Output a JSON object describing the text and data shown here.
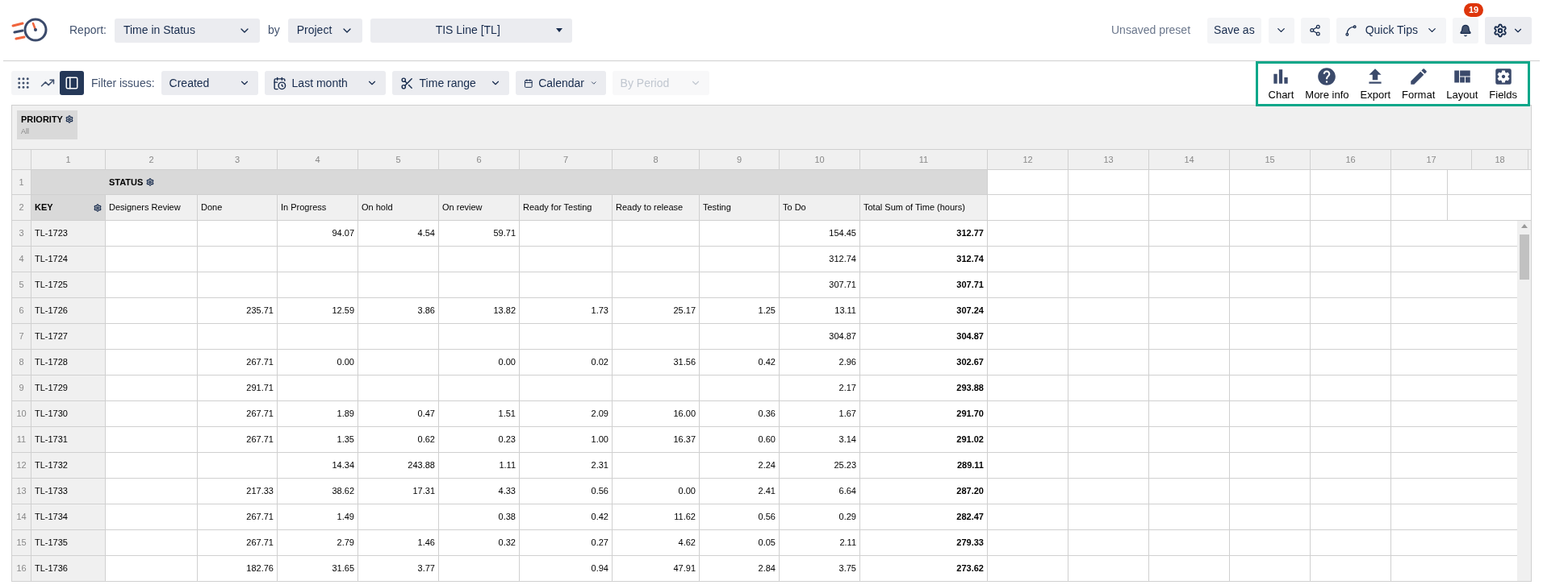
{
  "header": {
    "report_label": "Report:",
    "report_select": "Time in Status",
    "by_label": "by",
    "by_select": "Project",
    "project_select": "TIS Line [TL]",
    "preset_status": "Unsaved preset",
    "save_as": "Save as",
    "quick_tips": "Quick Tips",
    "notifications_count": "19"
  },
  "toolbar": {
    "views": [
      {
        "kind": "grid",
        "selected": false
      },
      {
        "kind": "chart",
        "selected": false
      },
      {
        "kind": "table",
        "selected": true
      }
    ],
    "filter_label": "Filter issues:",
    "filters": [
      {
        "kind": "select",
        "label": "Created",
        "disabled": false
      },
      {
        "kind": "period",
        "label": "Last month",
        "disabled": false
      },
      {
        "kind": "range",
        "label": "Time range",
        "disabled": false
      },
      {
        "kind": "calendar",
        "label": "Calendar",
        "disabled": false
      },
      {
        "kind": "select",
        "label": "By Period",
        "disabled": true
      }
    ],
    "actions": [
      {
        "kind": "chart",
        "label": "Chart"
      },
      {
        "kind": "info",
        "label": "More info"
      },
      {
        "kind": "export",
        "label": "Export"
      },
      {
        "kind": "format",
        "label": "Format"
      },
      {
        "kind": "layout",
        "label": "Layout"
      },
      {
        "kind": "fields",
        "label": "Fields"
      }
    ]
  },
  "priority_filter": {
    "label": "PRIORITY",
    "value": "All"
  },
  "table": {
    "column_numbers": [
      "1",
      "2",
      "3",
      "4",
      "5",
      "6",
      "7",
      "8",
      "9",
      "10",
      "11",
      "12",
      "13",
      "14",
      "15",
      "16",
      "17",
      "18"
    ],
    "row_numbers": [
      "1",
      "2"
    ],
    "status_header": "STATUS",
    "key_header": "KEY",
    "statuses": [
      "Designers Review",
      "Done",
      "In Progress",
      "On hold",
      "On review",
      "Ready for Testing",
      "Ready to release",
      "Testing",
      "To Do"
    ],
    "total_header": "Total Sum of Time (hours)",
    "rows": [
      {
        "number": "3",
        "key": "TL-1723",
        "cells": [
          {
            "kind": "empty"
          },
          {
            "kind": "empty"
          },
          {
            "kind": "value",
            "value": "94.07"
          },
          {
            "kind": "value",
            "value": "4.54"
          },
          {
            "kind": "value",
            "value": "59.71"
          },
          {
            "kind": "empty"
          },
          {
            "kind": "empty"
          },
          {
            "kind": "empty"
          },
          {
            "kind": "value",
            "value": "154.45"
          }
        ],
        "total": "312.77"
      },
      {
        "number": "4",
        "key": "TL-1724",
        "cells": [
          {
            "kind": "empty"
          },
          {
            "kind": "empty"
          },
          {
            "kind": "empty"
          },
          {
            "kind": "empty"
          },
          {
            "kind": "empty"
          },
          {
            "kind": "empty"
          },
          {
            "kind": "empty"
          },
          {
            "kind": "empty"
          },
          {
            "kind": "value",
            "value": "312.74"
          }
        ],
        "total": "312.74"
      },
      {
        "number": "5",
        "key": "TL-1725",
        "cells": [
          {
            "kind": "empty"
          },
          {
            "kind": "empty"
          },
          {
            "kind": "empty"
          },
          {
            "kind": "empty"
          },
          {
            "kind": "empty"
          },
          {
            "kind": "empty"
          },
          {
            "kind": "empty"
          },
          {
            "kind": "empty"
          },
          {
            "kind": "value",
            "value": "307.71"
          }
        ],
        "total": "307.71"
      },
      {
        "number": "6",
        "key": "TL-1726",
        "cells": [
          {
            "kind": "empty"
          },
          {
            "kind": "value",
            "value": "235.71"
          },
          {
            "kind": "value",
            "value": "12.59"
          },
          {
            "kind": "value",
            "value": "3.86"
          },
          {
            "kind": "value",
            "value": "13.82"
          },
          {
            "kind": "value",
            "value": "1.73"
          },
          {
            "kind": "value",
            "value": "25.17"
          },
          {
            "kind": "value",
            "value": "1.25"
          },
          {
            "kind": "value",
            "value": "13.11"
          }
        ],
        "total": "307.24"
      },
      {
        "number": "7",
        "key": "TL-1727",
        "cells": [
          {
            "kind": "empty"
          },
          {
            "kind": "empty"
          },
          {
            "kind": "empty"
          },
          {
            "kind": "empty"
          },
          {
            "kind": "empty"
          },
          {
            "kind": "empty"
          },
          {
            "kind": "empty"
          },
          {
            "kind": "empty"
          },
          {
            "kind": "value",
            "value": "304.87"
          }
        ],
        "total": "304.87"
      },
      {
        "number": "8",
        "key": "TL-1728",
        "cells": [
          {
            "kind": "empty"
          },
          {
            "kind": "value",
            "value": "267.71"
          },
          {
            "kind": "value",
            "value": "0.00"
          },
          {
            "kind": "empty"
          },
          {
            "kind": "value",
            "value": "0.00"
          },
          {
            "kind": "value",
            "value": "0.02"
          },
          {
            "kind": "value",
            "value": "31.56"
          },
          {
            "kind": "value",
            "value": "0.42"
          },
          {
            "kind": "value",
            "value": "2.96"
          }
        ],
        "total": "302.67"
      },
      {
        "number": "9",
        "key": "TL-1729",
        "cells": [
          {
            "kind": "empty"
          },
          {
            "kind": "value",
            "value": "291.71"
          },
          {
            "kind": "empty"
          },
          {
            "kind": "empty"
          },
          {
            "kind": "empty"
          },
          {
            "kind": "empty"
          },
          {
            "kind": "empty"
          },
          {
            "kind": "empty"
          },
          {
            "kind": "value",
            "value": "2.17"
          }
        ],
        "total": "293.88"
      },
      {
        "number": "10",
        "key": "TL-1730",
        "cells": [
          {
            "kind": "empty"
          },
          {
            "kind": "value",
            "value": "267.71"
          },
          {
            "kind": "value",
            "value": "1.89"
          },
          {
            "kind": "value",
            "value": "0.47"
          },
          {
            "kind": "value",
            "value": "1.51"
          },
          {
            "kind": "value",
            "value": "2.09"
          },
          {
            "kind": "value",
            "value": "16.00"
          },
          {
            "kind": "value",
            "value": "0.36"
          },
          {
            "kind": "value",
            "value": "1.67"
          }
        ],
        "total": "291.70"
      },
      {
        "number": "11",
        "key": "TL-1731",
        "cells": [
          {
            "kind": "empty"
          },
          {
            "kind": "value",
            "value": "267.71"
          },
          {
            "kind": "value",
            "value": "1.35"
          },
          {
            "kind": "value",
            "value": "0.62"
          },
          {
            "kind": "value",
            "value": "0.23"
          },
          {
            "kind": "value",
            "value": "1.00"
          },
          {
            "kind": "value",
            "value": "16.37"
          },
          {
            "kind": "value",
            "value": "0.60"
          },
          {
            "kind": "value",
            "value": "3.14"
          }
        ],
        "total": "291.02"
      },
      {
        "number": "12",
        "key": "TL-1732",
        "cells": [
          {
            "kind": "empty"
          },
          {
            "kind": "empty"
          },
          {
            "kind": "value",
            "value": "14.34"
          },
          {
            "kind": "value",
            "value": "243.88"
          },
          {
            "kind": "value",
            "value": "1.11"
          },
          {
            "kind": "value",
            "value": "2.31"
          },
          {
            "kind": "empty"
          },
          {
            "kind": "value",
            "value": "2.24"
          },
          {
            "kind": "value",
            "value": "25.23"
          }
        ],
        "total": "289.11"
      },
      {
        "number": "13",
        "key": "TL-1733",
        "cells": [
          {
            "kind": "empty"
          },
          {
            "kind": "value",
            "value": "217.33"
          },
          {
            "kind": "value",
            "value": "38.62"
          },
          {
            "kind": "value",
            "value": "17.31"
          },
          {
            "kind": "value",
            "value": "4.33"
          },
          {
            "kind": "value",
            "value": "0.56"
          },
          {
            "kind": "value",
            "value": "0.00"
          },
          {
            "kind": "value",
            "value": "2.41"
          },
          {
            "kind": "value",
            "value": "6.64"
          }
        ],
        "total": "287.20"
      },
      {
        "number": "14",
        "key": "TL-1734",
        "cells": [
          {
            "kind": "empty"
          },
          {
            "kind": "value",
            "value": "267.71"
          },
          {
            "kind": "value",
            "value": "1.49"
          },
          {
            "kind": "empty"
          },
          {
            "kind": "value",
            "value": "0.38"
          },
          {
            "kind": "value",
            "value": "0.42"
          },
          {
            "kind": "value",
            "value": "11.62"
          },
          {
            "kind": "value",
            "value": "0.56"
          },
          {
            "kind": "value",
            "value": "0.29"
          }
        ],
        "total": "282.47"
      },
      {
        "number": "15",
        "key": "TL-1735",
        "cells": [
          {
            "kind": "empty"
          },
          {
            "kind": "value",
            "value": "267.71"
          },
          {
            "kind": "value",
            "value": "2.79"
          },
          {
            "kind": "value",
            "value": "1.46"
          },
          {
            "kind": "value",
            "value": "0.32"
          },
          {
            "kind": "value",
            "value": "0.27"
          },
          {
            "kind": "value",
            "value": "4.62"
          },
          {
            "kind": "value",
            "value": "0.05"
          },
          {
            "kind": "value",
            "value": "2.11"
          }
        ],
        "total": "279.33"
      },
      {
        "number": "16",
        "key": "TL-1736",
        "cells": [
          {
            "kind": "empty"
          },
          {
            "kind": "value",
            "value": "182.76"
          },
          {
            "kind": "value",
            "value": "31.65"
          },
          {
            "kind": "value",
            "value": "3.77"
          },
          {
            "kind": "empty"
          },
          {
            "kind": "value",
            "value": "0.94"
          },
          {
            "kind": "value",
            "value": "47.91"
          },
          {
            "kind": "value",
            "value": "2.84"
          },
          {
            "kind": "value",
            "value": "3.75"
          }
        ],
        "total": "273.62"
      }
    ]
  }
}
